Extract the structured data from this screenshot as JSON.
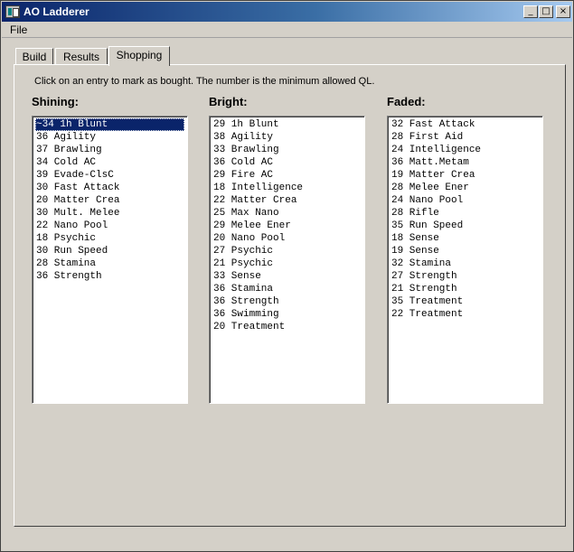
{
  "window": {
    "title": "AO Ladderer"
  },
  "menu": {
    "file": "File"
  },
  "tabs": [
    {
      "label": "Build"
    },
    {
      "label": "Results"
    },
    {
      "label": "Shopping"
    }
  ],
  "shopping": {
    "hint": "Click on an entry to mark as bought. The number is the minimum allowed QL.",
    "columns": [
      {
        "title": "Shining:",
        "items": [
          "~34 1h Blunt",
          "36 Agility",
          "37 Brawling",
          "34 Cold AC",
          "39 Evade-ClsC",
          "30 Fast Attack",
          "20 Matter Crea",
          "30 Mult. Melee",
          "22 Nano Pool",
          "18 Psychic",
          "30 Run Speed",
          "28 Stamina",
          "36 Strength"
        ],
        "selected_index": 0
      },
      {
        "title": "Bright:",
        "items": [
          "29 1h Blunt",
          "38 Agility",
          "33 Brawling",
          "36 Cold AC",
          "29 Fire AC",
          "18 Intelligence",
          "22 Matter Crea",
          "25 Max Nano",
          "29 Melee Ener",
          "20 Nano Pool",
          "27 Psychic",
          "21 Psychic",
          "33 Sense",
          "36 Stamina",
          "36 Strength",
          "36 Swimming",
          "20 Treatment"
        ]
      },
      {
        "title": "Faded:",
        "items": [
          "32 Fast Attack",
          "28 First Aid",
          "24 Intelligence",
          "36 Matt.Metam",
          "19 Matter Crea",
          "28 Melee Ener",
          "24 Nano Pool",
          "28 Rifle",
          "35 Run Speed",
          "18 Sense",
          "19 Sense",
          "32 Stamina",
          "27 Strength",
          "21 Strength",
          "35 Treatment",
          "22 Treatment"
        ]
      }
    ]
  }
}
